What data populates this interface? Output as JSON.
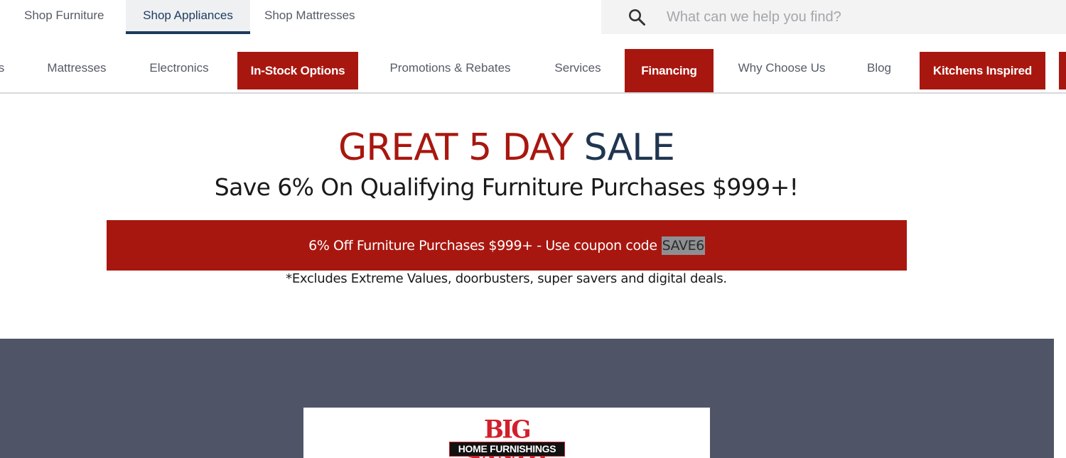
{
  "store_tabs": [
    {
      "label": "Shop Furniture",
      "active": false
    },
    {
      "label": "Shop Appliances",
      "active": true
    },
    {
      "label": "Shop Mattresses",
      "active": false
    }
  ],
  "search": {
    "placeholder": "What can we help you find?",
    "icon": "search-icon"
  },
  "main_nav": {
    "items": [
      {
        "label": "s",
        "highlight": false
      },
      {
        "label": "Mattresses",
        "highlight": false
      },
      {
        "label": "Electronics",
        "highlight": false
      },
      {
        "label": "In-Stock Options",
        "highlight": true
      },
      {
        "label": "Promotions & Rebates",
        "highlight": false
      },
      {
        "label": "Services",
        "highlight": false
      },
      {
        "label": "Financing",
        "highlight": true
      },
      {
        "label": "Why Choose Us",
        "highlight": false
      },
      {
        "label": "Blog",
        "highlight": false
      },
      {
        "label": "Kitchens Inspired",
        "highlight": true
      }
    ]
  },
  "banner": {
    "title_red": "GREAT 5 DAY",
    "title_navy": "SALE",
    "subtitle": "Save 6% On Qualifying Furniture Purchases $999+!",
    "coupon_text": "6% Off Furniture Purchases $999+ - Use coupon code",
    "coupon_code": "SAVE6",
    "excludes": "*Excludes Extreme Values, doorbusters, super savers and digital deals."
  },
  "logo": {
    "top": "BIG SANDY",
    "bottom": "HOME FURNISHINGS"
  },
  "colors": {
    "brand_red": "#a8170f",
    "navy": "#1f3550",
    "footer_bg": "#4f5567"
  }
}
